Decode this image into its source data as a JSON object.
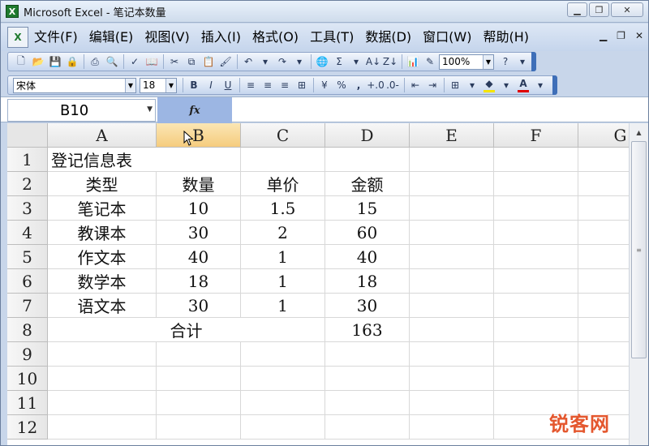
{
  "window": {
    "title": "Microsoft Excel - 笔记本数量",
    "app_icon": "excel-icon",
    "controls": [
      "minimize-icon",
      "restore-icon",
      "close-icon"
    ]
  },
  "menubar": {
    "items": [
      "文件(F)",
      "编辑(E)",
      "视图(V)",
      "插入(I)",
      "格式(O)",
      "工具(T)",
      "数据(D)",
      "窗口(W)",
      "帮助(H)"
    ],
    "doc_controls": [
      "minimize-icon",
      "restore-icon",
      "close-icon"
    ]
  },
  "standard_toolbar": {
    "zoom": "100%"
  },
  "format_toolbar": {
    "font_name": "宋体",
    "font_size": "18",
    "bold_label": "B",
    "italic_label": "I",
    "underline_label": "U",
    "percent_label": "%",
    "comma_label": ","
  },
  "formula_bar": {
    "name_box": "B10",
    "fx_label": "fx",
    "formula": ""
  },
  "grid": {
    "columns": [
      "A",
      "B",
      "C",
      "D",
      "E",
      "F",
      "G"
    ],
    "selected_column": "B",
    "rows": [
      "1",
      "2",
      "3",
      "4",
      "5",
      "6",
      "7",
      "8",
      "9",
      "10",
      "11",
      "12"
    ],
    "title": "登记信息表",
    "headers": [
      "类型",
      "数量",
      "单价",
      "金额"
    ],
    "data": [
      [
        "笔记本",
        "10",
        "1.5",
        "15"
      ],
      [
        "教课本",
        "30",
        "2",
        "60"
      ],
      [
        "作文本",
        "40",
        "1",
        "40"
      ],
      [
        "数学本",
        "18",
        "1",
        "18"
      ],
      [
        "语文本",
        "30",
        "1",
        "30"
      ]
    ],
    "total_label": "合计",
    "total_value": "163"
  },
  "watermark": "锐客网",
  "colors": {
    "title_bar": "#dfe8f5",
    "toolbar_grip": "#3f6fb8",
    "selected_header": "#f5cc7d",
    "fx_area": "#9cb6e3",
    "watermark": "#e4572e"
  }
}
